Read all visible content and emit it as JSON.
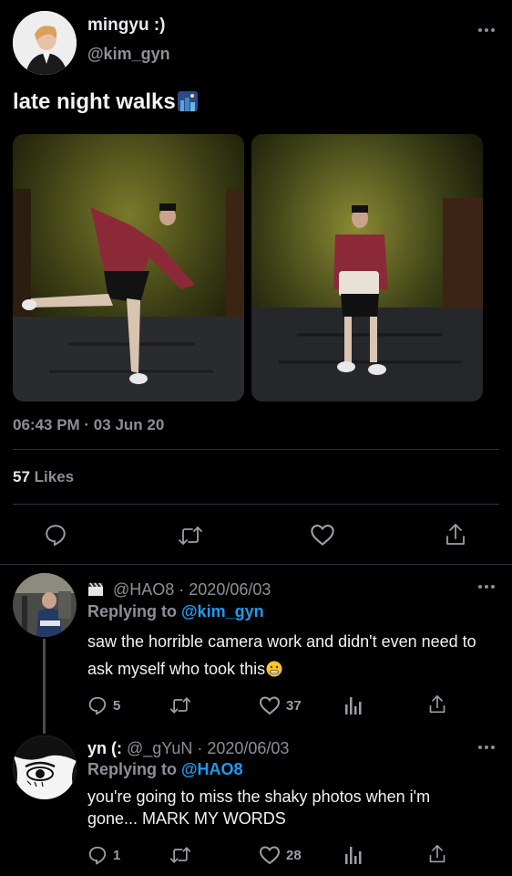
{
  "main_tweet": {
    "display_name": "mingyu :)",
    "handle": "@kim_gyn",
    "text": "late night walks",
    "emoji": "night-city-emoji",
    "timestamp": "06:43 PM · 03 Jun 20",
    "likes_count": "57",
    "likes_label": "Likes"
  },
  "replies": [
    {
      "display_prefix": "",
      "handle_date": "@HAO8 · 2020/06/03",
      "replying_label": "Replying to ",
      "replying_to": "@kim_gyn",
      "text": "saw the horrible camera work and didn't even need to ask myself who took this",
      "reply_count": "5",
      "like_count": "37"
    },
    {
      "display_name": "yn (:",
      "handle_date": "@_gYuN · 2020/06/03",
      "replying_label": "Replying to ",
      "replying_to": "@HAO8",
      "text_line1": "you're going to miss the shaky photos when i'm",
      "text_line2": "gone... MARK MY WORDS",
      "reply_count": "1",
      "like_count": "28"
    }
  ],
  "icons": {
    "more": "more-icon",
    "reply": "reply-icon",
    "retweet": "retweet-icon",
    "like": "like-icon",
    "share": "share-icon",
    "analytics": "analytics-icon"
  },
  "colors": {
    "background": "#000000",
    "text": "#e7e9ea",
    "muted": "#71767b",
    "accent": "#1d9bf0",
    "divider": "#2f3336"
  }
}
